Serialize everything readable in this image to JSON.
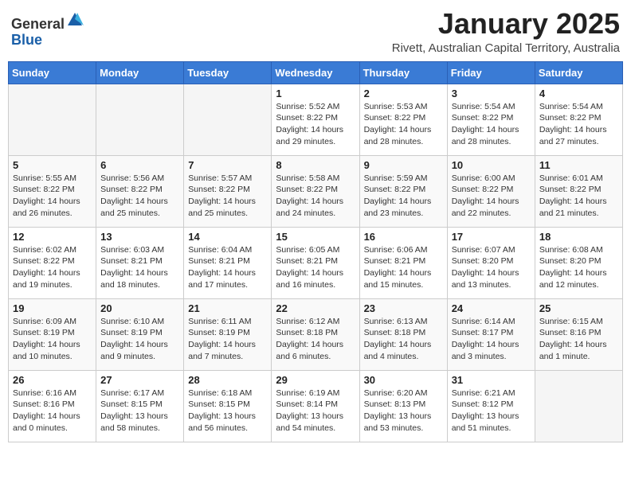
{
  "header": {
    "logo_general": "General",
    "logo_blue": "Blue",
    "month_title": "January 2025",
    "subtitle": "Rivett, Australian Capital Territory, Australia"
  },
  "days_of_week": [
    "Sunday",
    "Monday",
    "Tuesday",
    "Wednesday",
    "Thursday",
    "Friday",
    "Saturday"
  ],
  "weeks": [
    [
      {
        "num": "",
        "info": ""
      },
      {
        "num": "",
        "info": ""
      },
      {
        "num": "",
        "info": ""
      },
      {
        "num": "1",
        "info": "Sunrise: 5:52 AM\nSunset: 8:22 PM\nDaylight: 14 hours\nand 29 minutes."
      },
      {
        "num": "2",
        "info": "Sunrise: 5:53 AM\nSunset: 8:22 PM\nDaylight: 14 hours\nand 28 minutes."
      },
      {
        "num": "3",
        "info": "Sunrise: 5:54 AM\nSunset: 8:22 PM\nDaylight: 14 hours\nand 28 minutes."
      },
      {
        "num": "4",
        "info": "Sunrise: 5:54 AM\nSunset: 8:22 PM\nDaylight: 14 hours\nand 27 minutes."
      }
    ],
    [
      {
        "num": "5",
        "info": "Sunrise: 5:55 AM\nSunset: 8:22 PM\nDaylight: 14 hours\nand 26 minutes."
      },
      {
        "num": "6",
        "info": "Sunrise: 5:56 AM\nSunset: 8:22 PM\nDaylight: 14 hours\nand 25 minutes."
      },
      {
        "num": "7",
        "info": "Sunrise: 5:57 AM\nSunset: 8:22 PM\nDaylight: 14 hours\nand 25 minutes."
      },
      {
        "num": "8",
        "info": "Sunrise: 5:58 AM\nSunset: 8:22 PM\nDaylight: 14 hours\nand 24 minutes."
      },
      {
        "num": "9",
        "info": "Sunrise: 5:59 AM\nSunset: 8:22 PM\nDaylight: 14 hours\nand 23 minutes."
      },
      {
        "num": "10",
        "info": "Sunrise: 6:00 AM\nSunset: 8:22 PM\nDaylight: 14 hours\nand 22 minutes."
      },
      {
        "num": "11",
        "info": "Sunrise: 6:01 AM\nSunset: 8:22 PM\nDaylight: 14 hours\nand 21 minutes."
      }
    ],
    [
      {
        "num": "12",
        "info": "Sunrise: 6:02 AM\nSunset: 8:22 PM\nDaylight: 14 hours\nand 19 minutes."
      },
      {
        "num": "13",
        "info": "Sunrise: 6:03 AM\nSunset: 8:21 PM\nDaylight: 14 hours\nand 18 minutes."
      },
      {
        "num": "14",
        "info": "Sunrise: 6:04 AM\nSunset: 8:21 PM\nDaylight: 14 hours\nand 17 minutes."
      },
      {
        "num": "15",
        "info": "Sunrise: 6:05 AM\nSunset: 8:21 PM\nDaylight: 14 hours\nand 16 minutes."
      },
      {
        "num": "16",
        "info": "Sunrise: 6:06 AM\nSunset: 8:21 PM\nDaylight: 14 hours\nand 15 minutes."
      },
      {
        "num": "17",
        "info": "Sunrise: 6:07 AM\nSunset: 8:20 PM\nDaylight: 14 hours\nand 13 minutes."
      },
      {
        "num": "18",
        "info": "Sunrise: 6:08 AM\nSunset: 8:20 PM\nDaylight: 14 hours\nand 12 minutes."
      }
    ],
    [
      {
        "num": "19",
        "info": "Sunrise: 6:09 AM\nSunset: 8:19 PM\nDaylight: 14 hours\nand 10 minutes."
      },
      {
        "num": "20",
        "info": "Sunrise: 6:10 AM\nSunset: 8:19 PM\nDaylight: 14 hours\nand 9 minutes."
      },
      {
        "num": "21",
        "info": "Sunrise: 6:11 AM\nSunset: 8:19 PM\nDaylight: 14 hours\nand 7 minutes."
      },
      {
        "num": "22",
        "info": "Sunrise: 6:12 AM\nSunset: 8:18 PM\nDaylight: 14 hours\nand 6 minutes."
      },
      {
        "num": "23",
        "info": "Sunrise: 6:13 AM\nSunset: 8:18 PM\nDaylight: 14 hours\nand 4 minutes."
      },
      {
        "num": "24",
        "info": "Sunrise: 6:14 AM\nSunset: 8:17 PM\nDaylight: 14 hours\nand 3 minutes."
      },
      {
        "num": "25",
        "info": "Sunrise: 6:15 AM\nSunset: 8:16 PM\nDaylight: 14 hours\nand 1 minute."
      }
    ],
    [
      {
        "num": "26",
        "info": "Sunrise: 6:16 AM\nSunset: 8:16 PM\nDaylight: 14 hours\nand 0 minutes."
      },
      {
        "num": "27",
        "info": "Sunrise: 6:17 AM\nSunset: 8:15 PM\nDaylight: 13 hours\nand 58 minutes."
      },
      {
        "num": "28",
        "info": "Sunrise: 6:18 AM\nSunset: 8:15 PM\nDaylight: 13 hours\nand 56 minutes."
      },
      {
        "num": "29",
        "info": "Sunrise: 6:19 AM\nSunset: 8:14 PM\nDaylight: 13 hours\nand 54 minutes."
      },
      {
        "num": "30",
        "info": "Sunrise: 6:20 AM\nSunset: 8:13 PM\nDaylight: 13 hours\nand 53 minutes."
      },
      {
        "num": "31",
        "info": "Sunrise: 6:21 AM\nSunset: 8:12 PM\nDaylight: 13 hours\nand 51 minutes."
      },
      {
        "num": "",
        "info": ""
      }
    ]
  ]
}
